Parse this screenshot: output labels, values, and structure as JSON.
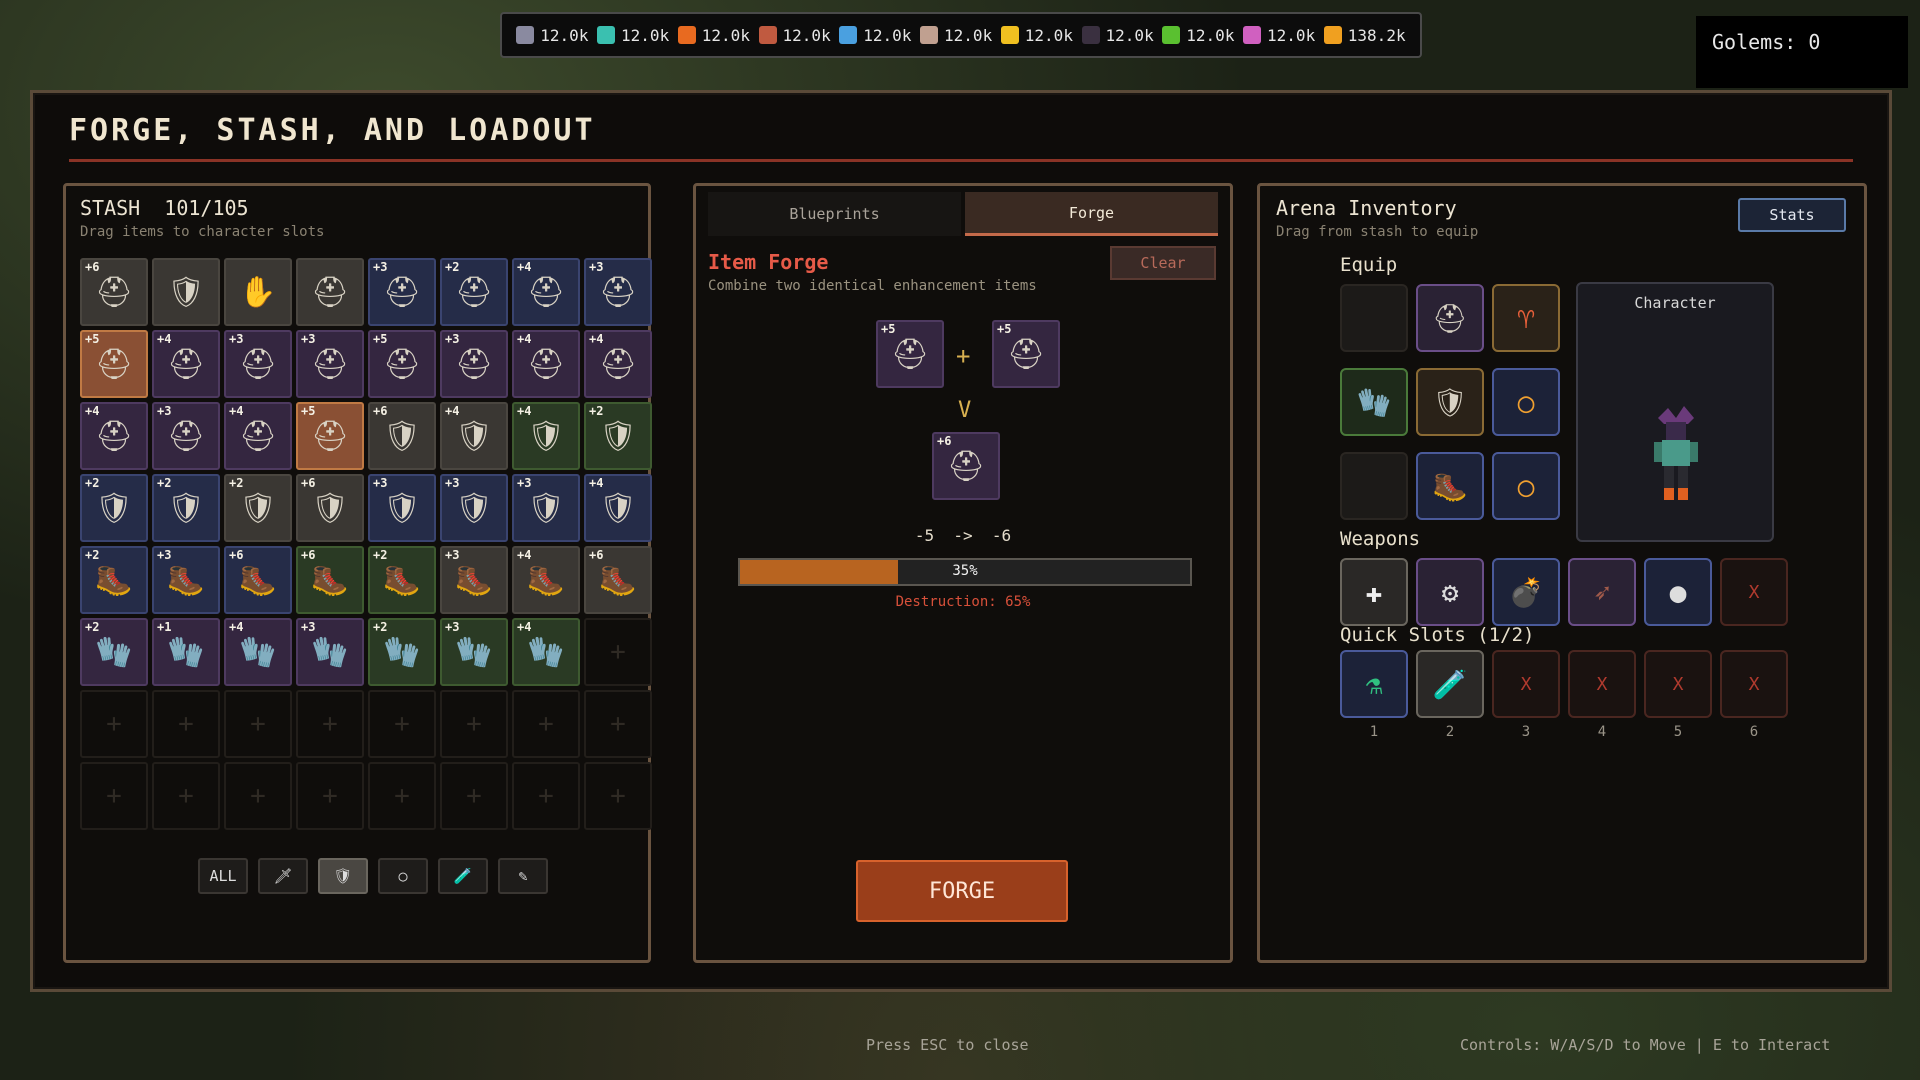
{
  "resources": [
    {
      "icon": "gem-icon",
      "color": "#8a8aa0",
      "value": "12.0k"
    },
    {
      "icon": "crystal-icon",
      "color": "#3ac0b0",
      "value": "12.0k"
    },
    {
      "icon": "fire-icon",
      "color": "#e86a20",
      "value": "12.0k"
    },
    {
      "icon": "herb-icon",
      "color": "#c05a40",
      "value": "12.0k"
    },
    {
      "icon": "ice-icon",
      "color": "#4aa0e0",
      "value": "12.0k"
    },
    {
      "icon": "skull-icon",
      "color": "#c0a090",
      "value": "12.0k"
    },
    {
      "icon": "lightning-icon",
      "color": "#f0c020",
      "value": "12.0k"
    },
    {
      "icon": "shadow-icon",
      "color": "#3a3040",
      "value": "12.0k"
    },
    {
      "icon": "vine-icon",
      "color": "#5ac030",
      "value": "12.0k"
    },
    {
      "icon": "swirl-icon",
      "color": "#d060c0",
      "value": "12.0k"
    },
    {
      "icon": "coin-icon",
      "color": "#f0a020",
      "value": "138.2k"
    }
  ],
  "golems": "Golems: 0",
  "title": "FORGE, STASH, AND LOADOUT",
  "stash": {
    "heading": "STASH  101/105",
    "subtitle": "Drag items to character slots",
    "items": [
      {
        "lvl": "+6",
        "glyph": "⛑",
        "rarity": "gray"
      },
      {
        "lvl": "",
        "glyph": "🛡",
        "rarity": "gray"
      },
      {
        "lvl": "",
        "glyph": "✋",
        "rarity": "gray"
      },
      {
        "lvl": "",
        "glyph": "⛑",
        "rarity": "gray"
      },
      {
        "lvl": "+3",
        "glyph": "⛑",
        "rarity": "blue"
      },
      {
        "lvl": "+2",
        "glyph": "⛑",
        "rarity": "blue"
      },
      {
        "lvl": "+4",
        "glyph": "⛑",
        "rarity": "blue"
      },
      {
        "lvl": "+3",
        "glyph": "⛑",
        "rarity": "blue"
      },
      {
        "lvl": "+5",
        "glyph": "⛑",
        "rarity": "orange"
      },
      {
        "lvl": "+4",
        "glyph": "⛑",
        "rarity": "purple"
      },
      {
        "lvl": "+3",
        "glyph": "⛑",
        "rarity": "purple"
      },
      {
        "lvl": "+3",
        "glyph": "⛑",
        "rarity": "purple"
      },
      {
        "lvl": "+5",
        "glyph": "⛑",
        "rarity": "purple"
      },
      {
        "lvl": "+3",
        "glyph": "⛑",
        "rarity": "purple"
      },
      {
        "lvl": "+4",
        "glyph": "⛑",
        "rarity": "purple"
      },
      {
        "lvl": "+4",
        "glyph": "⛑",
        "rarity": "purple"
      },
      {
        "lvl": "+4",
        "glyph": "⛑",
        "rarity": "purple"
      },
      {
        "lvl": "+3",
        "glyph": "⛑",
        "rarity": "purple"
      },
      {
        "lvl": "+4",
        "glyph": "⛑",
        "rarity": "purple"
      },
      {
        "lvl": "+5",
        "glyph": "⛑",
        "rarity": "orange"
      },
      {
        "lvl": "+6",
        "glyph": "🛡",
        "rarity": "gray"
      },
      {
        "lvl": "+4",
        "glyph": "🛡",
        "rarity": "gray"
      },
      {
        "lvl": "+4",
        "glyph": "🛡",
        "rarity": "green"
      },
      {
        "lvl": "+2",
        "glyph": "🛡",
        "rarity": "green"
      },
      {
        "lvl": "+2",
        "glyph": "🛡",
        "rarity": "blue"
      },
      {
        "lvl": "+2",
        "glyph": "🛡",
        "rarity": "blue"
      },
      {
        "lvl": "+2",
        "glyph": "🛡",
        "rarity": "gray"
      },
      {
        "lvl": "+6",
        "glyph": "🛡",
        "rarity": "gray"
      },
      {
        "lvl": "+3",
        "glyph": "🛡",
        "rarity": "blue"
      },
      {
        "lvl": "+3",
        "glyph": "🛡",
        "rarity": "blue"
      },
      {
        "lvl": "+3",
        "glyph": "🛡",
        "rarity": "blue"
      },
      {
        "lvl": "+4",
        "glyph": "🛡",
        "rarity": "blue"
      },
      {
        "lvl": "+2",
        "glyph": "🥾",
        "rarity": "blue"
      },
      {
        "lvl": "+3",
        "glyph": "🥾",
        "rarity": "blue"
      },
      {
        "lvl": "+6",
        "glyph": "🥾",
        "rarity": "blue"
      },
      {
        "lvl": "+6",
        "glyph": "🥾",
        "rarity": "green"
      },
      {
        "lvl": "+2",
        "glyph": "🥾",
        "rarity": "green"
      },
      {
        "lvl": "+3",
        "glyph": "🥾",
        "rarity": "gray"
      },
      {
        "lvl": "+4",
        "glyph": "🥾",
        "rarity": "gray"
      },
      {
        "lvl": "+6",
        "glyph": "🥾",
        "rarity": "gray"
      },
      {
        "lvl": "+2",
        "glyph": "🧤",
        "rarity": "purple"
      },
      {
        "lvl": "+1",
        "glyph": "🧤",
        "rarity": "purple"
      },
      {
        "lvl": "+4",
        "glyph": "🧤",
        "rarity": "purple"
      },
      {
        "lvl": "+3",
        "glyph": "🧤",
        "rarity": "purple"
      },
      {
        "lvl": "+2",
        "glyph": "🧤",
        "rarity": "green"
      },
      {
        "lvl": "+3",
        "glyph": "🧤",
        "rarity": "green"
      },
      {
        "lvl": "+4",
        "glyph": "🧤",
        "rarity": "green"
      }
    ],
    "filters": [
      {
        "label": "ALL",
        "name": "filter-all-button",
        "active": false
      },
      {
        "label": "🗡",
        "name": "filter-weapon-button",
        "active": false
      },
      {
        "label": "🛡",
        "name": "filter-armor-button",
        "active": true
      },
      {
        "label": "○",
        "name": "filter-ring-button",
        "active": false
      },
      {
        "label": "🧪",
        "name": "filter-potion-button",
        "active": false
      },
      {
        "label": "✎",
        "name": "filter-misc-button",
        "active": false
      }
    ]
  },
  "forge": {
    "tabs": [
      "Blueprints",
      "Forge"
    ],
    "heading": "Item Forge",
    "subtitle": "Combine two identical enhancement items",
    "clear_label": "Clear",
    "input_a_lvl": "+5",
    "input_b_lvl": "+5",
    "result_lvl": "+6",
    "plus": "+",
    "arrow": "V",
    "level_change": "-5  ->  -6",
    "success_percent": 35,
    "success_label": "35%",
    "destruction_label": "Destruction: 65%",
    "forge_label": "FORGE"
  },
  "arena": {
    "heading": "Arena Inventory",
    "subtitle": "Drag from stash to equip",
    "stats_label": "Stats",
    "equip_heading": "Equip",
    "character_label": "Character",
    "weapons_heading": "Weapons",
    "quick_heading": "Quick Slots (1/2)",
    "quick_numbers": [
      "1",
      "2",
      "3",
      "4",
      "5",
      "6"
    ],
    "empty_mark": "X"
  },
  "footer": {
    "esc": "Press ESC to close",
    "controls": "Controls: W/A/S/D to Move | E to Interact"
  }
}
